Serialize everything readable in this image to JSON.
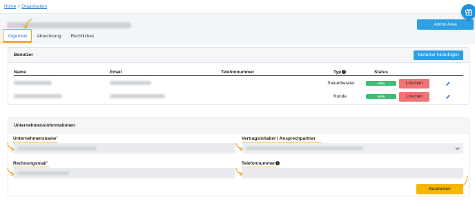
{
  "breadcrumb": {
    "home": "Home",
    "separator": "/",
    "current": "Organisation"
  },
  "header": {
    "admin_button": "Admin Area"
  },
  "tabs": [
    {
      "label": "Allgemein",
      "active": true
    },
    {
      "label": "Abrechnung",
      "active": false
    },
    {
      "label": "Rechtliches",
      "active": false
    }
  ],
  "users_card": {
    "title": "Benutzer",
    "add_button": "Benutzer hinzufügen",
    "columns": {
      "name": "Name",
      "email": "Email",
      "phone": "Telefonnummer",
      "type": "Typ",
      "status": "Status"
    },
    "rows": [
      {
        "type": "Steuerberater",
        "status": "Aktiv",
        "delete": "Löschen"
      },
      {
        "type": "Kunde",
        "status": "Aktiv",
        "delete": "Löschen"
      }
    ]
  },
  "company_card": {
    "title": "Unternehmensinformationen",
    "fields": {
      "company_name": "Unternehmensname",
      "contract_holder": "Vertragsinhaber / Ansprechpartner",
      "billing_mail": "Rechnungsmail",
      "phone": "Telefonnummer"
    },
    "required_mark": "*",
    "edit_button": "Bearbeiten"
  },
  "colors": {
    "primary": "#2d9fe3",
    "danger": "#f07474",
    "success": "#3cbf72",
    "warning": "#f5b800",
    "annotation": "#f5a623"
  },
  "icons": [
    "gift-icon",
    "info-icon",
    "pencil-icon",
    "chevron-down-icon",
    "annotation-arrow-icon"
  ]
}
